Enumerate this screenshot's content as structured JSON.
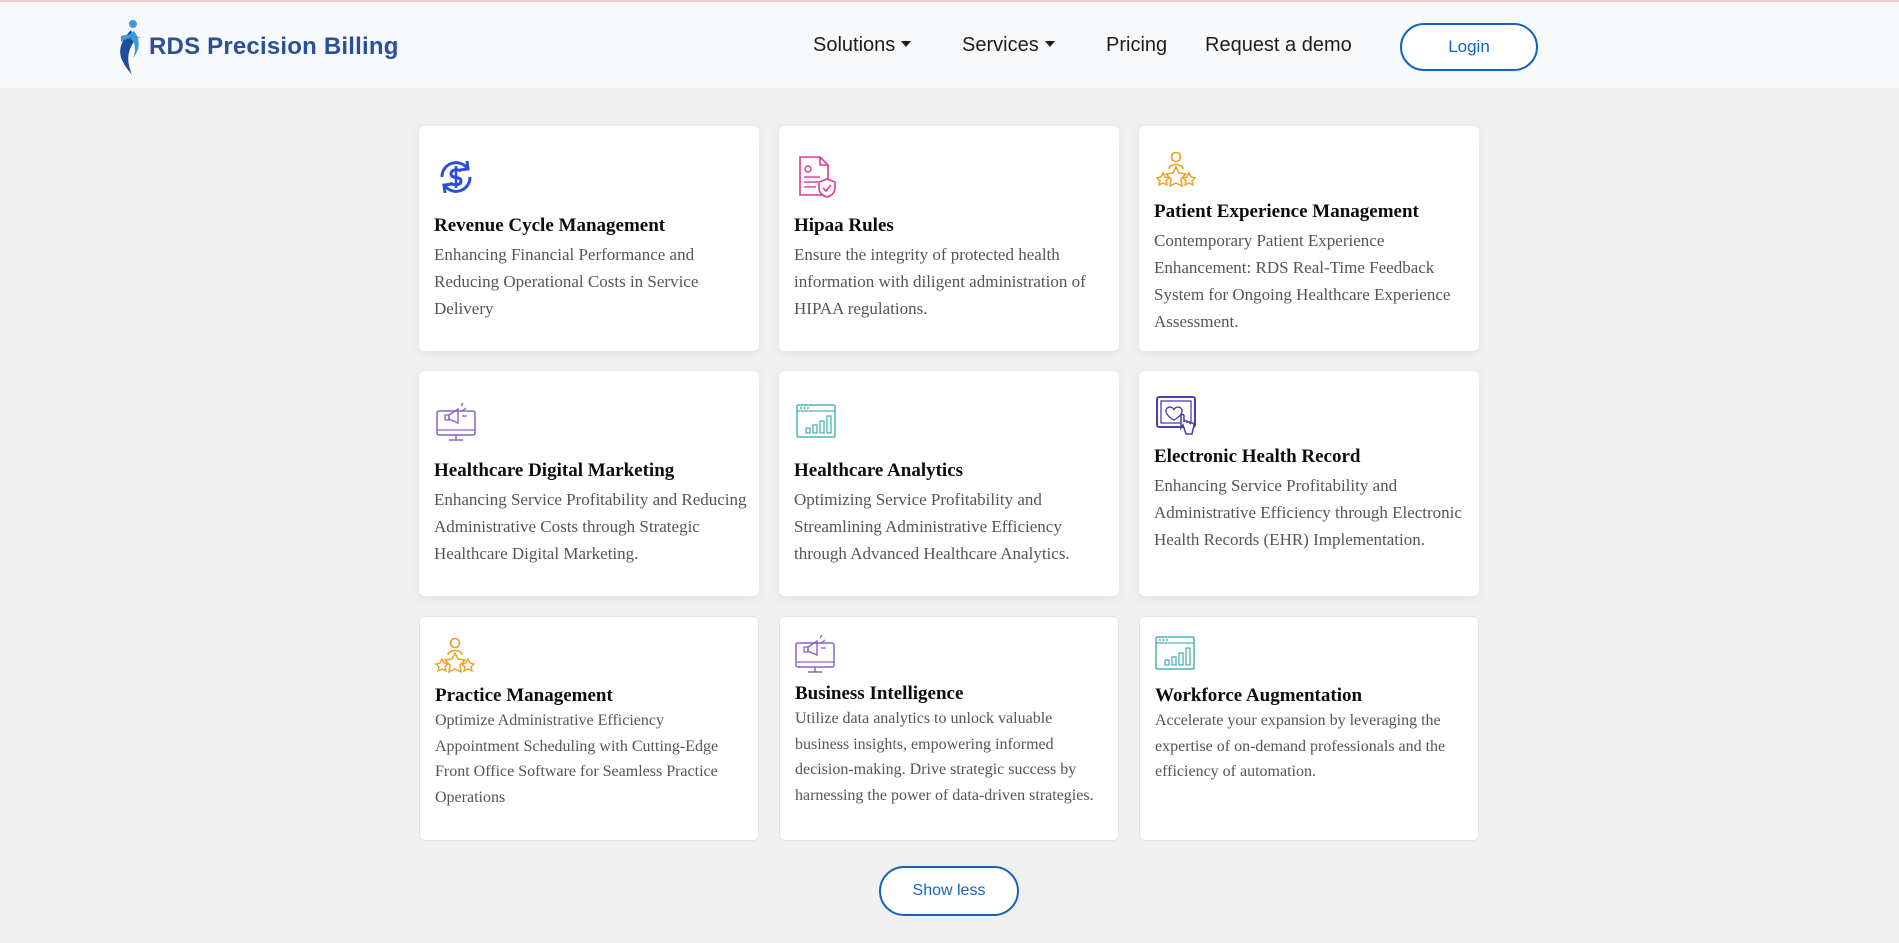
{
  "brand": {
    "name": "RDS Precision Billing"
  },
  "nav": {
    "solutions": "Solutions",
    "services": "Services",
    "pricing": "Pricing",
    "demo": "Request a demo",
    "login": "Login"
  },
  "cards": [
    {
      "icon": "dollar-cycle-icon",
      "title": "Revenue Cycle Management",
      "description": "Enhancing Financial Performance and Reducing Operational Costs in Service Delivery"
    },
    {
      "icon": "document-shield-icon",
      "title": "Hipaa Rules",
      "description": "Ensure the integrity of protected health information with diligent administration of HIPAA regulations."
    },
    {
      "icon": "person-stars-icon",
      "title": "Patient Experience Management",
      "description": "Contemporary Patient Experience Enhancement: RDS Real-Time Feedback System for Ongoing Healthcare Experience Assessment."
    },
    {
      "icon": "monitor-megaphone-icon",
      "title": "Healthcare Digital Marketing",
      "description": "Enhancing Service Profitability and Reducing Administrative Costs through Strategic Healthcare Digital Marketing."
    },
    {
      "icon": "browser-chart-icon",
      "title": "Healthcare Analytics",
      "description": "Optimizing Service Profitability and Streamlining Administrative Efficiency through Advanced Healthcare Analytics."
    },
    {
      "icon": "touch-screen-icon",
      "title": "Electronic Health Record",
      "description": "Enhancing Service Profitability and Administrative Efficiency through Electronic Health Records (EHR) Implementation."
    },
    {
      "icon": "person-stars-icon",
      "title": "Practice Management",
      "description": "Optimize Administrative Efficiency Appointment Scheduling with Cutting-Edge Front Office Software for Seamless Practice Operations"
    },
    {
      "icon": "monitor-megaphone-icon",
      "title": "Business Intelligence",
      "description": "Utilize data analytics to unlock valuable business insights, empowering informed decision-making. Drive strategic success by harnessing the power of data-driven strategies."
    },
    {
      "icon": "browser-chart-icon",
      "title": "Workforce Augmentation",
      "description": "Accelerate your expansion by leveraging the expertise of on-demand professionals and the efficiency of automation."
    }
  ],
  "colors": {
    "brand": "#2a4f9c",
    "accent": "#1464bd",
    "icon_blue": "#2b4fd8",
    "icon_pink": "#e0399a",
    "icon_orange": "#f0a020",
    "icon_purple": "#8a64c8",
    "icon_teal": "#4db3b3",
    "icon_indigo": "#4a3fb0"
  },
  "footer_action": {
    "show_less": "Show less"
  }
}
